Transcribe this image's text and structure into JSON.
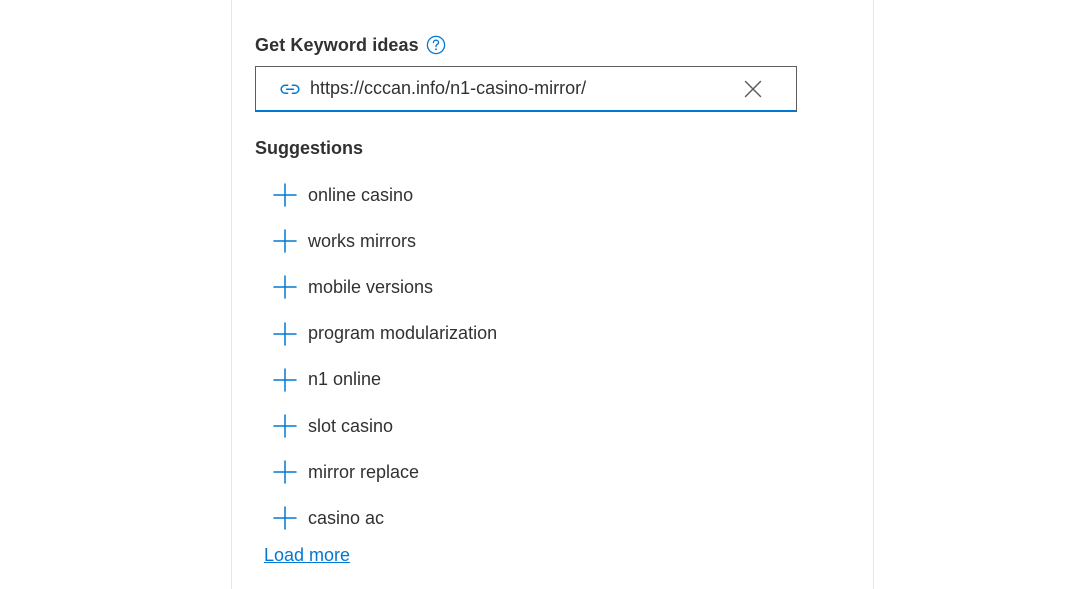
{
  "keyword_ideas": {
    "title": "Get Keyword ideas",
    "help_icon": "question-circle-icon",
    "url_input": {
      "value": "https://cccan.info/n1-casino-mirror/",
      "link_icon": "link-icon",
      "clear_icon": "close-icon"
    }
  },
  "suggestions": {
    "title": "Suggestions",
    "add_icon": "plus-icon",
    "items": [
      {
        "label": "online casino"
      },
      {
        "label": "works mirrors"
      },
      {
        "label": "mobile versions"
      },
      {
        "label": "program modularization"
      },
      {
        "label": "n1 online"
      },
      {
        "label": "slot casino"
      },
      {
        "label": "mirror replace"
      },
      {
        "label": "casino ac"
      }
    ],
    "load_more_label": "Load more"
  },
  "colors": {
    "accent": "#0078d4",
    "text": "#323130",
    "border": "#605e5c"
  }
}
